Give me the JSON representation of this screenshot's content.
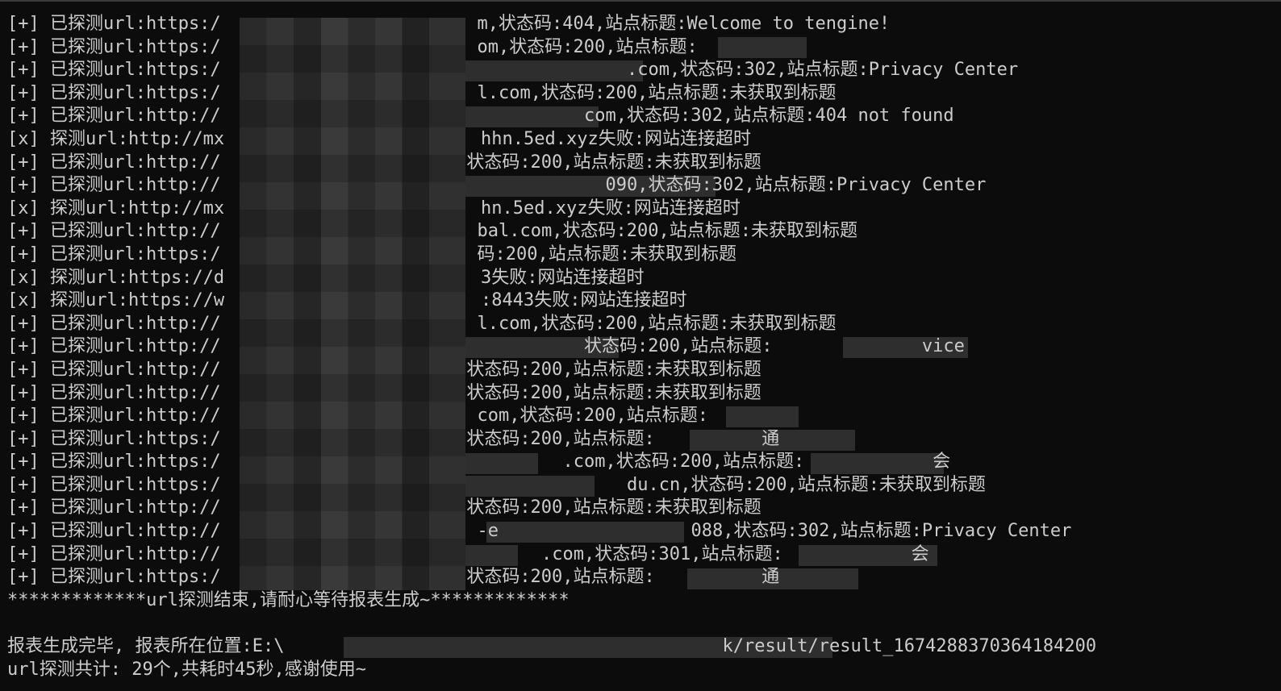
{
  "window": {
    "lines": [
      "[+] 已探测url:https:/                        m,状态码:404,站点标题:Welcome to tengine!",
      "[+] 已探测url:https:/                        om,状态码:200,站点标题:",
      "[+] 已探测url:https:/                                      .com,状态码:302,站点标题:Privacy Center",
      "[+] 已探测url:https:/                        l.com,状态码:200,站点标题:未获取到标题",
      "[+] 已探测url:http://                                  com,状态码:302,站点标题:404 not found",
      "[x] 探测url:http://mx                        hhn.5ed.xyz失败:网站连接超时",
      "[+] 已探测url:http://                       状态码:200,站点标题:未获取到标题",
      "[+] 已探测url:http://                                    090,状态码:302,站点标题:Privacy Center",
      "[x] 探测url:http://mx                        hn.5ed.xyz失败:网站连接超时",
      "[+] 已探测url:http://                        bal.com,状态码:200,站点标题:未获取到标题",
      "[+] 已探测url:https:/                        码:200,站点标题:未获取到标题",
      "[x] 探测url:https://d                        3失败:网站连接超时",
      "[x] 探测url:https://w                        :8443失败:网站连接超时",
      "[+] 已探测url:http://                        l.com,状态码:200,站点标题:未获取到标题",
      "[+] 已探测url:http://                                  状态码:200,站点标题:              vice",
      "[+] 已探测url:http://                       状态码:200,站点标题:未获取到标题",
      "[+] 已探测url:http://                       状态码:200,站点标题:未获取到标题",
      "[+] 已探测url:http://                        com,状态码:200,站点标题:",
      "[+] 已探测url:https:/                       状态码:200,站点标题:          通",
      "[+] 已探测url:https:/                                .com,状态码:200,站点标题:            会",
      "[+] 已探测url:https:/                                      du.cn,状态码:200,站点标题:未获取到标题",
      "[+] 已探测url:http://                       状态码:200,站点标题:未获取到标题",
      "[+] 已探测url:http://                        -e                  088,状态码:302,站点标题:Privacy Center",
      "[+] 已探测url:http://                              .com,状态码:301,站点标题:            会",
      "[+] 已探测url:https:/                       状态码:200,站点标题:          通",
      "*************url探测结束,请耐心等待报表生成~*************",
      "",
      "报表生成完毕, 报表所在位置:E:\\                                         k/result/result_1674288370364184200",
      "url探测共计: 29个,共耗时45秒,感谢使用~"
    ]
  },
  "colors": {
    "background": "#0c0c0c",
    "text": "#cccccc",
    "redaction": "#2e2e2e"
  }
}
